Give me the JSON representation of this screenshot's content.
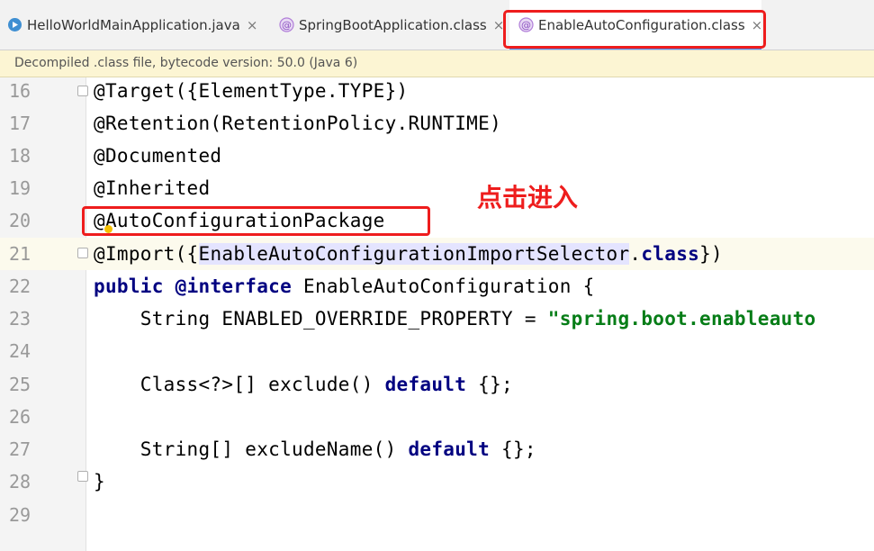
{
  "tabs": [
    {
      "label": "HelloWorldMainApplication.java",
      "icon": "java-class-icon",
      "active": false
    },
    {
      "label": "SpringBootApplication.class",
      "icon": "annotation-icon",
      "active": false
    },
    {
      "label": "EnableAutoConfiguration.class",
      "icon": "annotation-icon",
      "active": true
    }
  ],
  "banner": "Decompiled .class file, bytecode version: 50.0 (Java 6)",
  "annotation": "点击进入",
  "colors": {
    "highlight": "#ee1d1d",
    "keyword": "#000080",
    "string": "#067d17",
    "tab_accent": "#4b8ef0"
  },
  "lines": [
    {
      "num": "16",
      "code": "@Target({ElementType.TYPE})"
    },
    {
      "num": "17",
      "code": "@Retention(RetentionPolicy.RUNTIME)"
    },
    {
      "num": "18",
      "code": "@Documented"
    },
    {
      "num": "19",
      "code": "@Inherited"
    },
    {
      "num": "20",
      "code": "@AutoConfigurationPackage"
    },
    {
      "num": "21",
      "code_parts": [
        "@Import({",
        "EnableAutoConfigurationImportSelector",
        ".",
        "class",
        "})"
      ]
    },
    {
      "num": "22",
      "code_parts": [
        "public",
        " ",
        "@interface",
        " EnableAutoConfiguration {"
      ]
    },
    {
      "num": "23",
      "code_parts": [
        "    String ENABLED_OVERRIDE_PROPERTY = ",
        "\"spring.boot.enableauto"
      ]
    },
    {
      "num": "24",
      "code": ""
    },
    {
      "num": "25",
      "code_parts": [
        "    Class<?>[] exclude() ",
        "default",
        " {};"
      ]
    },
    {
      "num": "26",
      "code": ""
    },
    {
      "num": "27",
      "code_parts": [
        "    String[] excludeName() ",
        "default",
        " {};"
      ]
    },
    {
      "num": "28",
      "code": "}"
    },
    {
      "num": "29",
      "code": ""
    }
  ]
}
